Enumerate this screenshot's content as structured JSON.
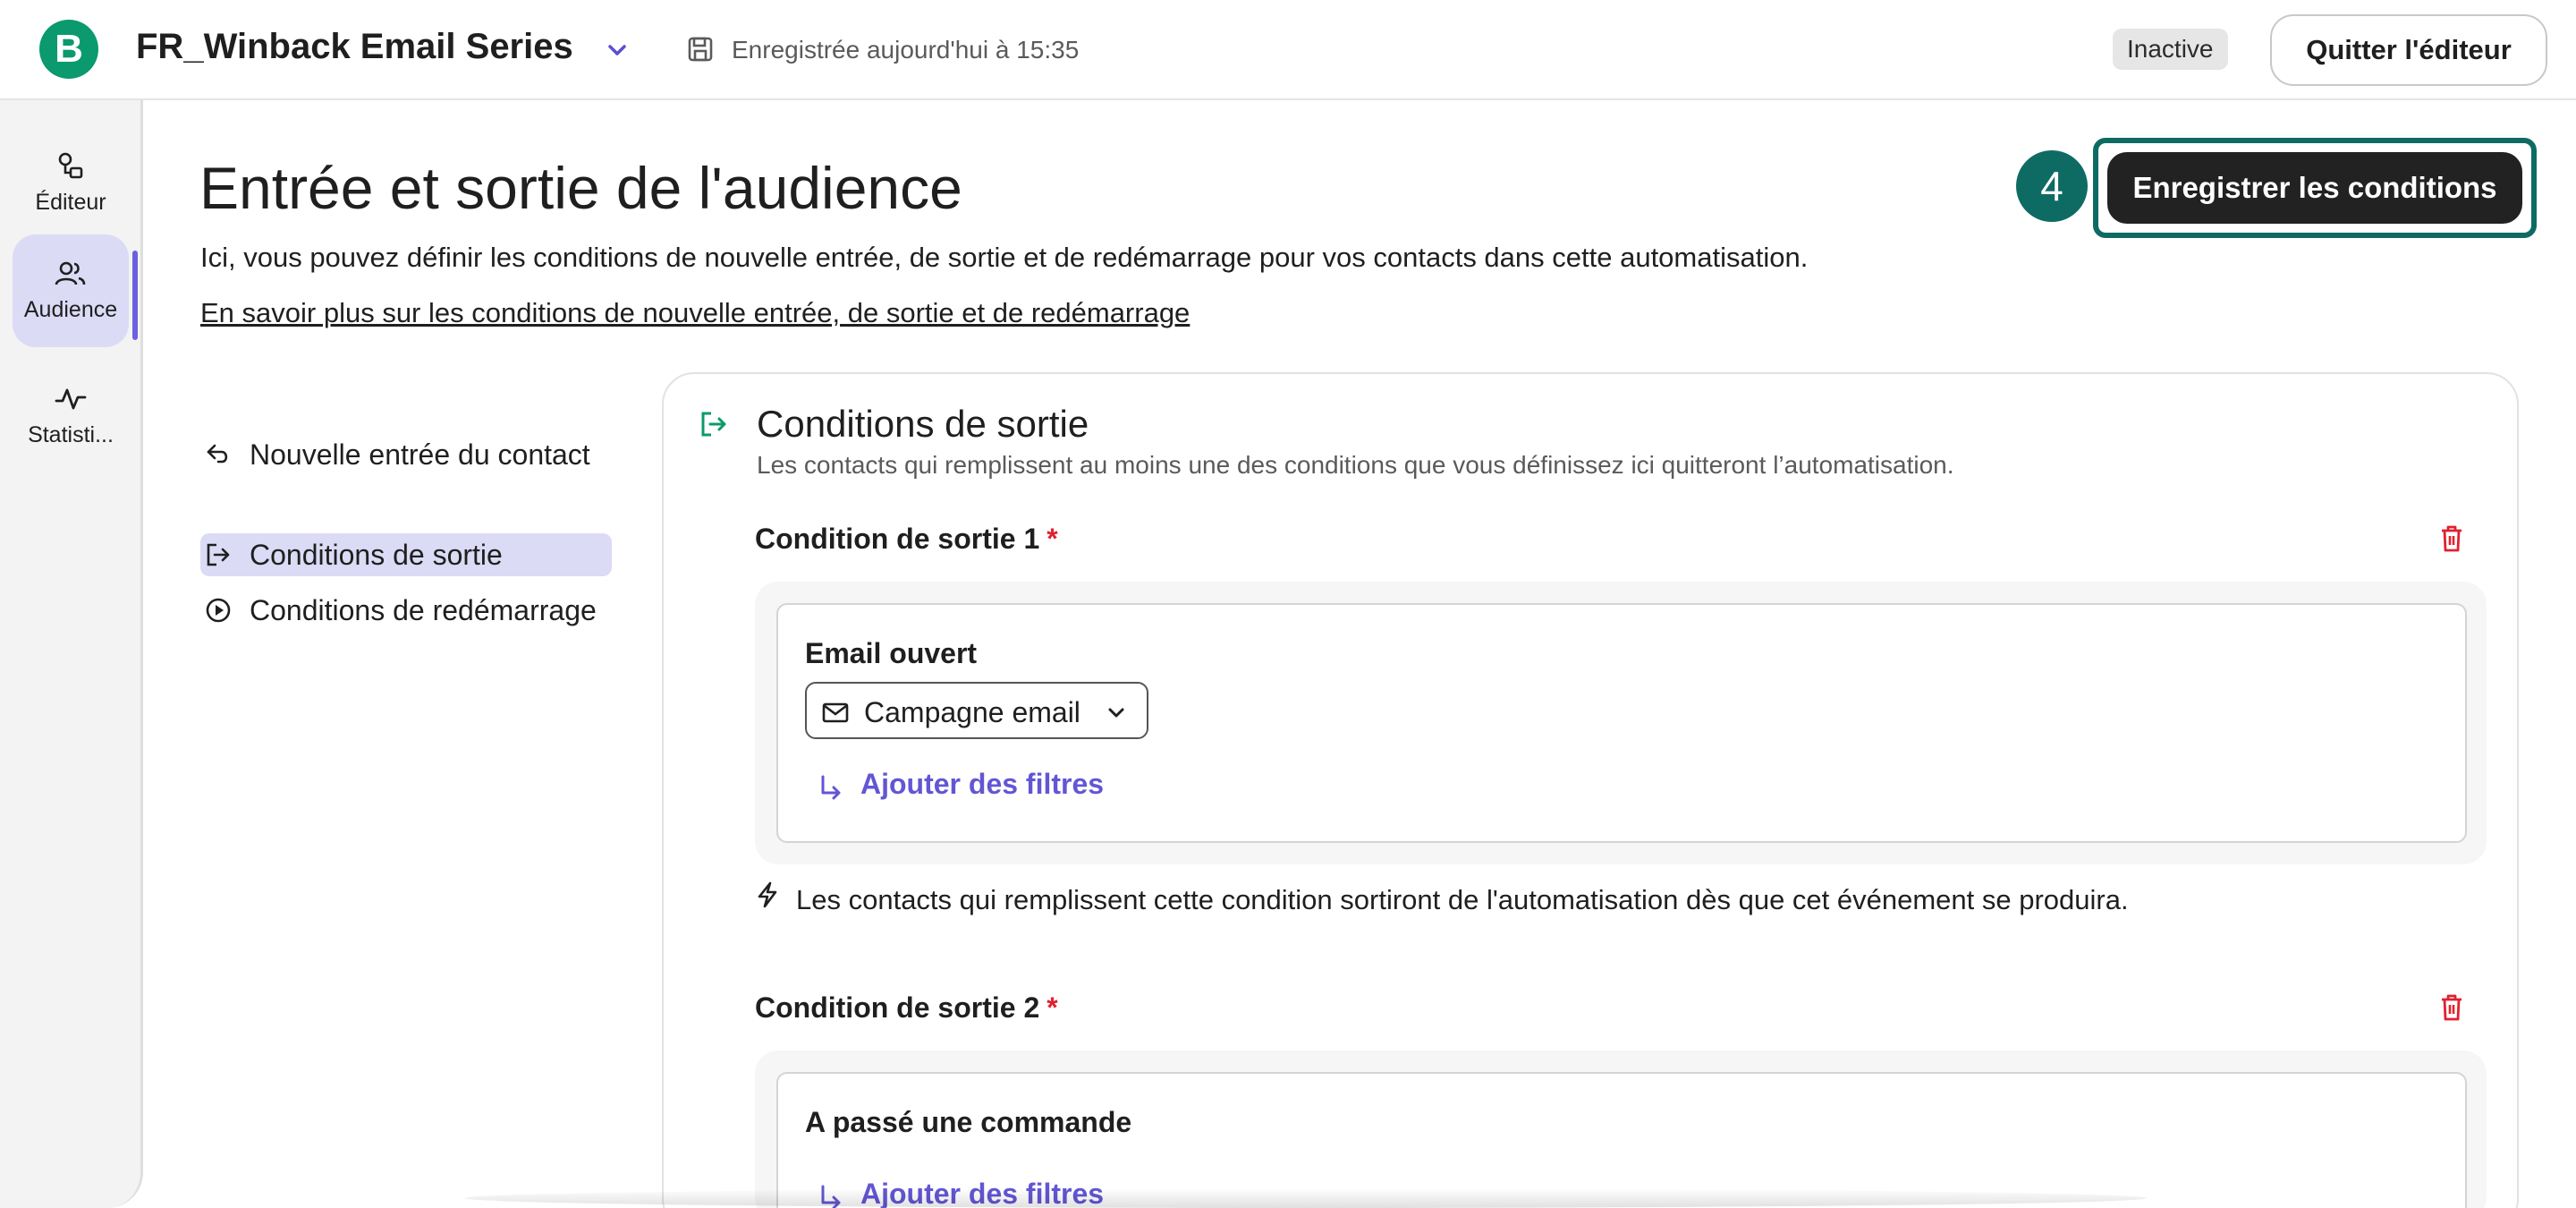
{
  "header": {
    "logo_letter": "B",
    "title": "FR_Winback Email Series",
    "save_status": "Enregistrée aujourd'hui à 15:35",
    "status_badge": "Inactive",
    "quit_label": "Quitter l'éditeur"
  },
  "sidebar": {
    "items": [
      {
        "label": "Éditeur",
        "icon": "editor-icon",
        "active": false
      },
      {
        "label": "Audience",
        "icon": "audience-icon",
        "active": true
      },
      {
        "label": "Statisti...",
        "icon": "statistics-icon",
        "active": false
      }
    ]
  },
  "main": {
    "title": "Entrée et sortie de l'audience",
    "description": "Ici, vous pouvez définir les conditions de nouvelle entrée, de sortie et de redémarrage pour vos contacts dans cette automatisation.",
    "learn_more": "En savoir plus sur les conditions de nouvelle entrée, de sortie et de redémarrage",
    "step_number": "4",
    "save_button": "Enregistrer les conditions"
  },
  "section_nav": {
    "items": [
      {
        "label": "Nouvelle entrée du contact",
        "active": false
      },
      {
        "label": "Conditions de sortie",
        "active": true
      },
      {
        "label": "Conditions de redémarrage",
        "active": false
      }
    ]
  },
  "panel": {
    "title": "Conditions de sortie",
    "subtitle": "Les contacts qui remplissent au moins une des conditions que vous définissez ici quitteront l’automatisation.",
    "conditions": [
      {
        "label": "Condition de sortie 1",
        "required_mark": "*",
        "event": "Email ouvert",
        "select_value": "Campagne email",
        "add_filters": "Ajouter des filtres"
      },
      {
        "label": "Condition de sortie 2",
        "required_mark": "*",
        "event": "A passé une commande",
        "add_filters": "Ajouter des filtres"
      }
    ],
    "trigger_note": "Les contacts qui remplissent cette condition sortiront de l'automatisation dès que cet événement se produira."
  },
  "colors": {
    "brand_green": "#0b996e",
    "accent_purple": "#6256d4",
    "highlight_teal": "#0e6b63",
    "danger_red": "#e0212f"
  }
}
